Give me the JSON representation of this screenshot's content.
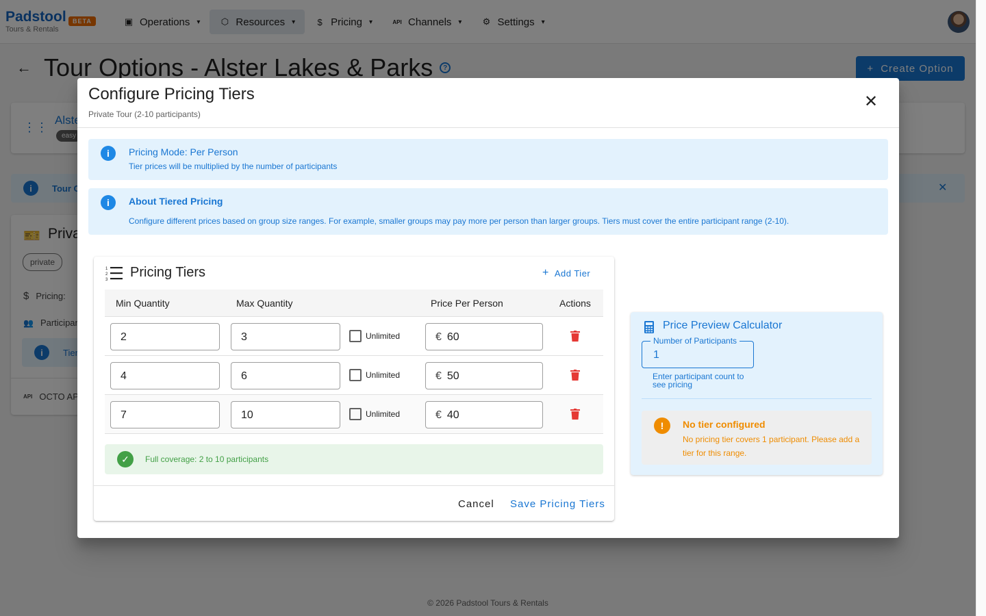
{
  "app": {
    "brand": "Padstool",
    "badge": "BETA",
    "subtitle": "Tours & Rentals",
    "nav": [
      {
        "label": "Operations",
        "icon": "clipboard-icon"
      },
      {
        "label": "Resources",
        "icon": "cube-icon"
      },
      {
        "label": "Pricing",
        "icon": "dollar-icon"
      },
      {
        "label": "Channels",
        "icon": "api-icon"
      },
      {
        "label": "Settings",
        "icon": "gear-icon"
      }
    ],
    "active_nav": "Resources"
  },
  "page": {
    "title": "Tour Options - Alster Lakes & Parks",
    "create_button": "Create Option",
    "product_card": {
      "name": "Alste",
      "chip": "easy"
    },
    "info_strip": "Tour O",
    "option_card": {
      "title": "Priva",
      "chip": "private",
      "pricing_label": "Pricing:",
      "participants_label": "Participan",
      "inner_text": "Tier",
      "octo_label": "OCTO AP"
    },
    "footer": "© 2026 Padstool Tours & Rentals"
  },
  "dialog": {
    "title": "Configure Pricing Tiers",
    "subtitle": "Private Tour (2-10 participants)",
    "mode_alert": {
      "heading": "Pricing Mode: Per Person",
      "body": "Tier prices will be multiplied by the number of participants"
    },
    "about_alert": {
      "heading": "About Tiered Pricing",
      "body": "Configure different prices based on group size ranges. For example, smaller groups may pay more per person than larger groups. Tiers must cover the entire participant range (2-10)."
    },
    "tiers": {
      "title": "Pricing Tiers",
      "add_label": "Add Tier",
      "columns": {
        "min": "Min Quantity",
        "max": "Max Quantity",
        "price": "Price Per Person",
        "actions": "Actions"
      },
      "unlimited_label": "Unlimited",
      "currency": "€",
      "rows": [
        {
          "min": "2",
          "max": "3",
          "price": "60",
          "unlimited": false
        },
        {
          "min": "4",
          "max": "6",
          "price": "50",
          "unlimited": false
        },
        {
          "min": "7",
          "max": "10",
          "price": "40",
          "unlimited": false
        }
      ],
      "coverage": "Full coverage: 2 to 10 participants"
    },
    "actions": {
      "cancel": "Cancel",
      "save": "Save Pricing Tiers"
    },
    "calculator": {
      "title": "Price Preview Calculator",
      "field_label": "Number of Participants",
      "field_value": "1",
      "help": "Enter participant count to see pricing",
      "warning_heading": "No tier configured",
      "warning_body": "No pricing tier covers 1 participant. Please add a tier for this range."
    }
  },
  "colors": {
    "primary": "#1976d2",
    "warning": "#ef8c00",
    "success": "#43a047",
    "danger": "#e53935",
    "beta": "#ef6c00"
  }
}
